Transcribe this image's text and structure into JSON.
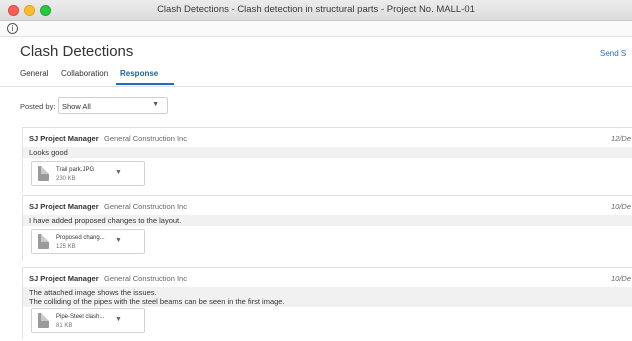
{
  "window": {
    "title": "Clash Detections - Clash detection in structural parts - Project No. MALL-01"
  },
  "infobar": {
    "icon": "info-icon"
  },
  "page": {
    "title": "Clash Detections",
    "send_link": "Send S"
  },
  "tabs": [
    {
      "label": "General",
      "active": false
    },
    {
      "label": "Collaboration",
      "active": false
    },
    {
      "label": "Response",
      "active": true
    }
  ],
  "filter": {
    "label": "Posted by:",
    "value": "Show All"
  },
  "responses": [
    {
      "author": "SJ Project Manager",
      "company": "General Construction Inc",
      "date": "12/De",
      "message_lines": [
        "Looks good"
      ],
      "attachment": {
        "name": "Trail park.JPG",
        "size": "230 KB"
      }
    },
    {
      "author": "SJ Project Manager",
      "company": "General Construction Inc",
      "date": "10/De",
      "message_lines": [
        "I have added proposed changes to the layout."
      ],
      "attachment": {
        "name": "Proposed chang...",
        "size": "125 KB"
      }
    },
    {
      "author": "SJ Project Manager",
      "company": "General Construction Inc",
      "date": "10/De",
      "message_lines": [
        "The attached image shows the issues.",
        "The colliding of the pipes with the steel beams can be seen in the first image."
      ],
      "attachment": {
        "name": "Pipe-Steel clash...",
        "size": "81 KB"
      }
    }
  ],
  "colors": {
    "accent": "#1f6fc2",
    "link": "#2a6ebb",
    "message_bg": "#f1f1f1"
  }
}
